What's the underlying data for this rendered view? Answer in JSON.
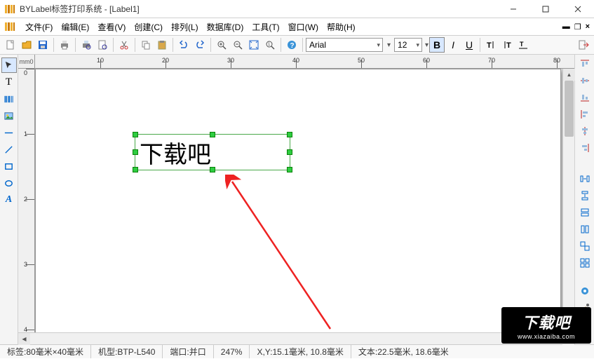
{
  "window": {
    "title": "BYLabel标签打印系统 - [Label1]"
  },
  "menu": {
    "file": "文件(F)",
    "edit": "编辑(E)",
    "view": "查看(V)",
    "create": "创建(C)",
    "arrange": "排列(L)",
    "database": "数据库(D)",
    "tools": "工具(T)",
    "window": "窗口(W)",
    "help": "帮助(H)"
  },
  "toolbar": {
    "font_name": "Arial",
    "font_size": "12"
  },
  "ruler": {
    "unit": "mm0",
    "h_ticks": [
      "10",
      "20",
      "30",
      "40",
      "50",
      "60",
      "70",
      "80"
    ],
    "v_ticks": [
      "0",
      "1",
      "2",
      "3",
      "4"
    ]
  },
  "canvas": {
    "text_content": "下载吧"
  },
  "status": {
    "label_size": "标签:80毫米×40毫米",
    "model": "机型:BTP-L540",
    "port": "端口:并口",
    "zoom": "247%",
    "coords": "X,Y:15.1毫米, 10.8毫米",
    "text_info": "文本:22.5毫米, 18.6毫米"
  },
  "watermark": {
    "main": "下载吧",
    "sub": "www.xiazaiba.com"
  }
}
